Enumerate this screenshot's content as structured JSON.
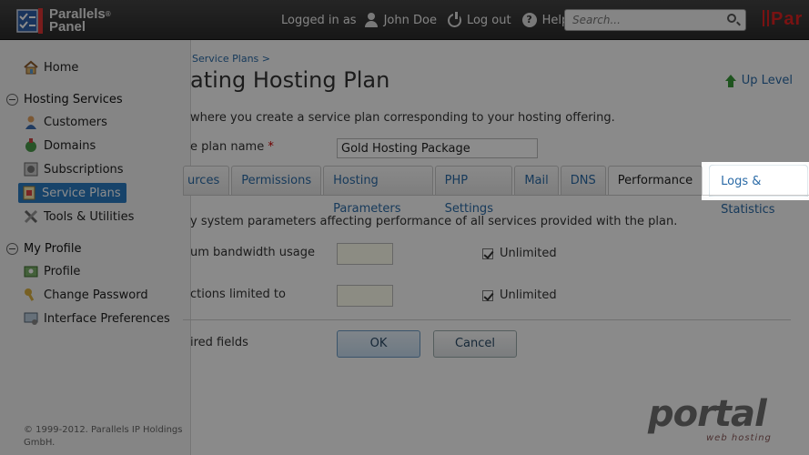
{
  "header": {
    "logo_line1": "Parallels",
    "logo_reg": "®",
    "logo_line2": "Panel",
    "logged_in_as": "Logged in as",
    "user_name": "John Doe",
    "logout": "Log out",
    "help": "Help",
    "search_placeholder": "Search...",
    "brand_mark": "Par"
  },
  "sidebar": {
    "home": "Home",
    "group_hosting": "Hosting Services",
    "customers": "Customers",
    "domains": "Domains",
    "subscriptions": "Subscriptions",
    "service_plans": "Service Plans",
    "tools": "Tools & Utilities",
    "group_profile": "My Profile",
    "profile": "Profile",
    "change_password": "Change Password",
    "interface_prefs": "Interface Preferences",
    "copyright": "© 1999-2012. Parallels IP Holdings GmbH."
  },
  "main": {
    "breadcrumb": "Service Plans >",
    "title": "ating Hosting Plan",
    "up_level": "Up Level",
    "intro": "where you create a service plan corresponding to your hosting offering.",
    "plan_name_label": "e plan name",
    "required_mark": "*",
    "plan_name_value": "Gold Hosting Package",
    "tabs": [
      "urces",
      "Permissions",
      "Hosting Parameters",
      "PHP Settings",
      "Mail",
      "DNS",
      "Performance",
      "Logs & Statistics"
    ],
    "description": "y system parameters affecting performance of all services provided with the plan.",
    "bandwidth_label": "um bandwidth usage",
    "connections_label": "ctions limited to",
    "unlimited": "Unlimited",
    "required_fields": "ired fields",
    "ok": "OK",
    "cancel": "Cancel"
  },
  "watermark": {
    "text": "portal",
    "sub": "web hosting"
  },
  "colors": {
    "accent": "#2a7bc2",
    "link": "#2a6aa6",
    "header_bg": "#2b2b2b",
    "brand_red": "#d22"
  }
}
